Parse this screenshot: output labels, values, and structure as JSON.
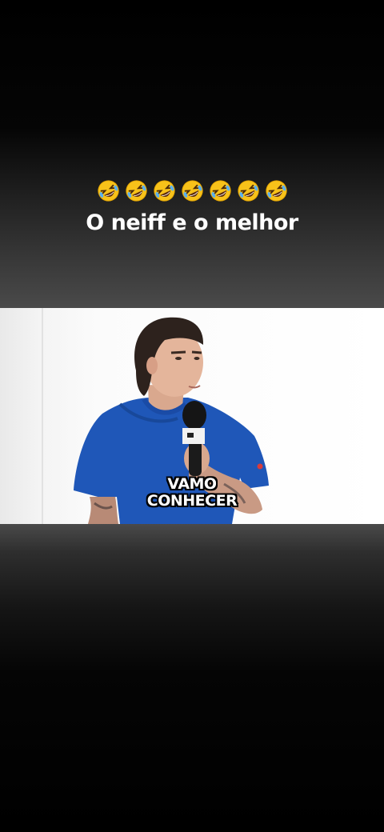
{
  "caption": {
    "emojis": [
      "rolling-on-floor-laughing-emoji",
      "rolling-on-floor-laughing-emoji",
      "rolling-on-floor-laughing-emoji",
      "rolling-on-floor-laughing-emoji",
      "rolling-on-floor-laughing-emoji",
      "rolling-on-floor-laughing-emoji",
      "rolling-on-floor-laughing-emoji"
    ],
    "text": "O neiff e o melhor"
  },
  "video": {
    "subtitle_line1": "VAMO",
    "subtitle_line2": "CONHECER"
  },
  "colors": {
    "caption_text": "#ffffff",
    "shirt": "#1f57b8",
    "background_top": "#000000",
    "band_gray": "#4a4a4a"
  }
}
